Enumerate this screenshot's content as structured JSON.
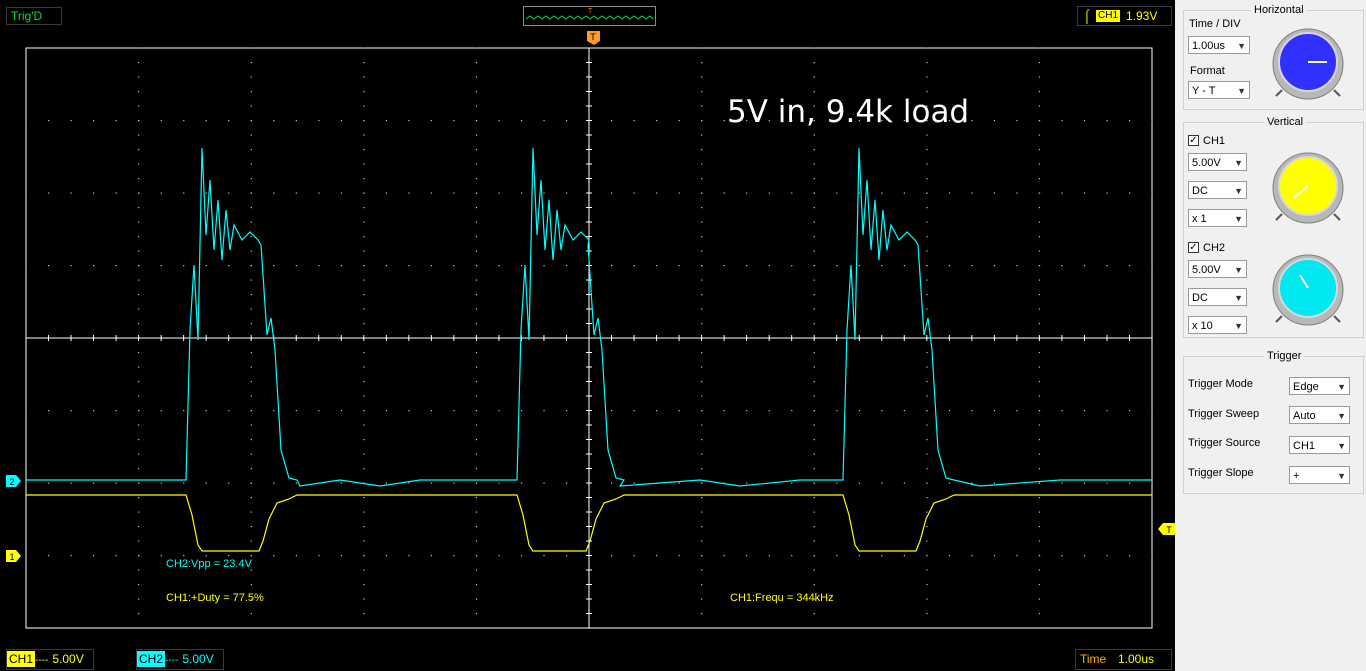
{
  "top": {
    "trigger_status": "Trig'D",
    "trigger_channel": "CH1",
    "trigger_level": "1.93V",
    "overview_marker": "T"
  },
  "screen": {
    "annotation": "5V in, 9.4k load",
    "trigger_marker": "T",
    "ch1_marker": "1",
    "ch2_marker": "2",
    "meas_vpp": "CH2:Vpp = 23.4V",
    "meas_duty": "CH1:+Duty = 77.5%",
    "meas_freq": "CH1:Frequ = 344kHz",
    "colors": {
      "ch1": "#ffff00",
      "ch2": "#00ffff",
      "grid": "#ffffff",
      "background": "#000000"
    }
  },
  "bottom": {
    "ch1_label": "CH1",
    "ch1_dash": "----",
    "ch1_value": "5.00V",
    "ch2_label": "CH2",
    "ch2_dash": "----",
    "ch2_value": "5.00V",
    "time_label": "Time",
    "time_value": "1.00us"
  },
  "panel": {
    "horizontal": {
      "title": "Horizontal",
      "time_div_label": "Time / DIV",
      "time_div_value": "1.00us",
      "format_label": "Format",
      "format_value": "Y - T",
      "knob_color": "#3030ff"
    },
    "vertical": {
      "title": "Vertical",
      "ch1": {
        "label": "CH1",
        "checked": true,
        "volts": "5.00V",
        "coupling": "DC",
        "probe": "x 1",
        "knob_color": "#ffff00"
      },
      "ch2": {
        "label": "CH2",
        "checked": true,
        "volts": "5.00V",
        "coupling": "DC",
        "probe": "x 10",
        "knob_color": "#00ffff"
      }
    },
    "trigger": {
      "title": "Trigger",
      "mode_label": "Trigger Mode",
      "mode_value": "Edge",
      "sweep_label": "Trigger Sweep",
      "sweep_value": "Auto",
      "source_label": "Trigger Source",
      "source_value": "CH1",
      "slope_label": "Trigger Slope",
      "slope_value": "+"
    }
  }
}
